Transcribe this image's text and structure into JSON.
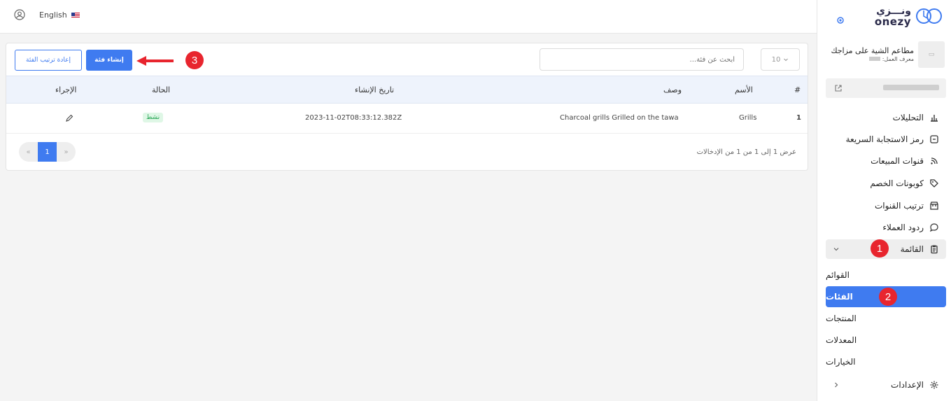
{
  "header": {
    "language": "English"
  },
  "sidebar": {
    "logo_arabic": "ونـــزي",
    "logo_latin": "onezy",
    "store_name": "مطاعم الشية على مزاجك",
    "store_id_label": "معرف العمل:",
    "menu": [
      {
        "label": "التحليلات",
        "icon": "chart-icon"
      },
      {
        "label": "رمز الاستجابة السريعة",
        "icon": "qr-icon"
      },
      {
        "label": "قنوات المبيعات",
        "icon": "rss-icon"
      },
      {
        "label": "كوبونات الخصم",
        "icon": "tag-icon"
      },
      {
        "label": "ترتيب القنوات",
        "icon": "store-icon"
      },
      {
        "label": "ردود العملاء",
        "icon": "chat-icon"
      },
      {
        "label": "القائمة",
        "icon": "clipboard-icon"
      }
    ],
    "submenu": [
      {
        "label": "القوائم"
      },
      {
        "label": "الفئات"
      },
      {
        "label": "المنتجات"
      },
      {
        "label": "المعدلات"
      },
      {
        "label": "الخيارات"
      }
    ],
    "settings_label": "الإعدادات"
  },
  "toolbar": {
    "reorder_label": "إعادة ترتيب الفئة",
    "create_label": "إنشاء فئة",
    "search_placeholder": "أبحث عن فئة...",
    "page_size": "10"
  },
  "table": {
    "headers": {
      "index": "#",
      "name": "الأسم",
      "description": "وصف",
      "created": "تاريخ الإنشاء",
      "status": "الحالة",
      "action": "الإجراء"
    },
    "rows": [
      {
        "index": "1",
        "name": "Grills",
        "description": "Charcoal grills Grilled on the tawa",
        "created": "2023-11-02T08:33:12.382Z",
        "status": "نشط"
      }
    ]
  },
  "pagination": {
    "prev": "«",
    "current": "1",
    "next": "»",
    "summary": "عرض 1 إلى 1 من 1 من الإدخالات"
  },
  "annotations": {
    "step1": "1",
    "step2": "2",
    "step3": "3"
  },
  "colors": {
    "primary": "#3f7bf0",
    "marker": "#e8252e",
    "active_badge_bg": "#dff7e6",
    "active_badge_text": "#21a350"
  }
}
